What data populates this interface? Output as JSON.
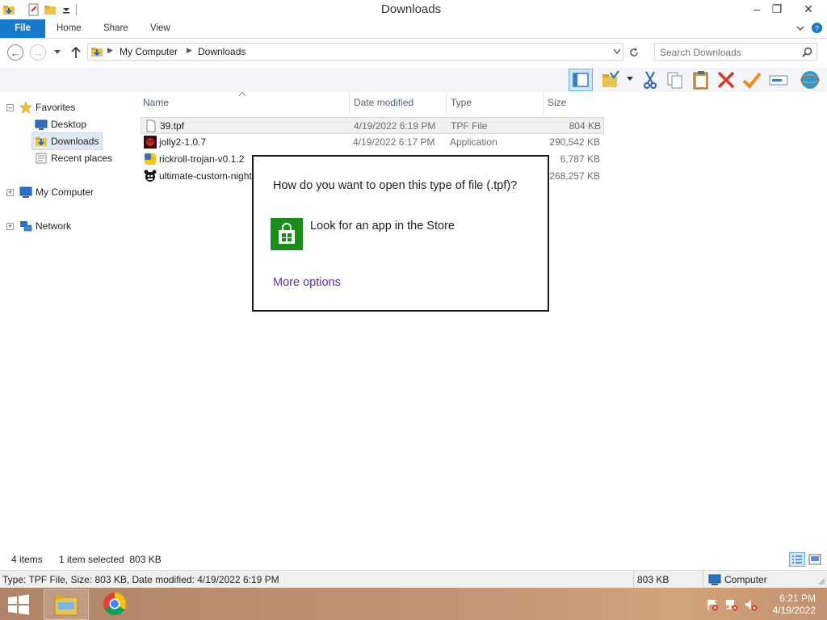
{
  "window": {
    "title": "Downloads",
    "minimize": "‒",
    "maximize": "❐",
    "close": "✕"
  },
  "ribbon": {
    "tabs": [
      "File",
      "Home",
      "Share",
      "View"
    ],
    "expand_icon": "chevron-down-icon",
    "help_icon": "help-icon"
  },
  "address": {
    "segments": [
      "My Computer",
      "Downloads"
    ],
    "search_placeholder": "Search Downloads"
  },
  "navpane": {
    "favorites": "Favorites",
    "desktop": "Desktop",
    "downloads": "Downloads",
    "recent": "Recent places",
    "computer": "My Computer",
    "network": "Network"
  },
  "list": {
    "columns": [
      "Name",
      "Date modified",
      "Type",
      "Size"
    ],
    "rows": [
      {
        "name": "39.tpf",
        "date": "4/19/2022 6:19 PM",
        "type": "TPF File",
        "size": "804 KB"
      },
      {
        "name": "jolly2-1.0.7",
        "date": "4/19/2022 6:17 PM",
        "type": "Application",
        "size": "290,542 KB"
      },
      {
        "name": "rickroll-trojan-v0.1.2",
        "date": "",
        "type": "",
        "size": "6,787 KB"
      },
      {
        "name": "ultimate-custom-night",
        "date": "",
        "type": "",
        "size": "268,257 KB"
      }
    ]
  },
  "dialog": {
    "question": "How do you want to open this type of file (.tpf)?",
    "store_option": "Look for an app in the Store",
    "more_options": "More options"
  },
  "status": {
    "items": "4 items",
    "selected": "1 item selected  803 KB"
  },
  "details": {
    "info": "Type: TPF File, Size: 803 KB, Date modified: 4/19/2022 6:19 PM",
    "size": "803 KB",
    "location": "Computer"
  },
  "taskbar": {
    "time": "6:21 PM",
    "date": "4/19/2022"
  },
  "colors": {
    "file_tab": "#1979ca",
    "store_tile": "#1a8e1a",
    "link": "#5a2fb0",
    "taskbar": "#c59675"
  }
}
